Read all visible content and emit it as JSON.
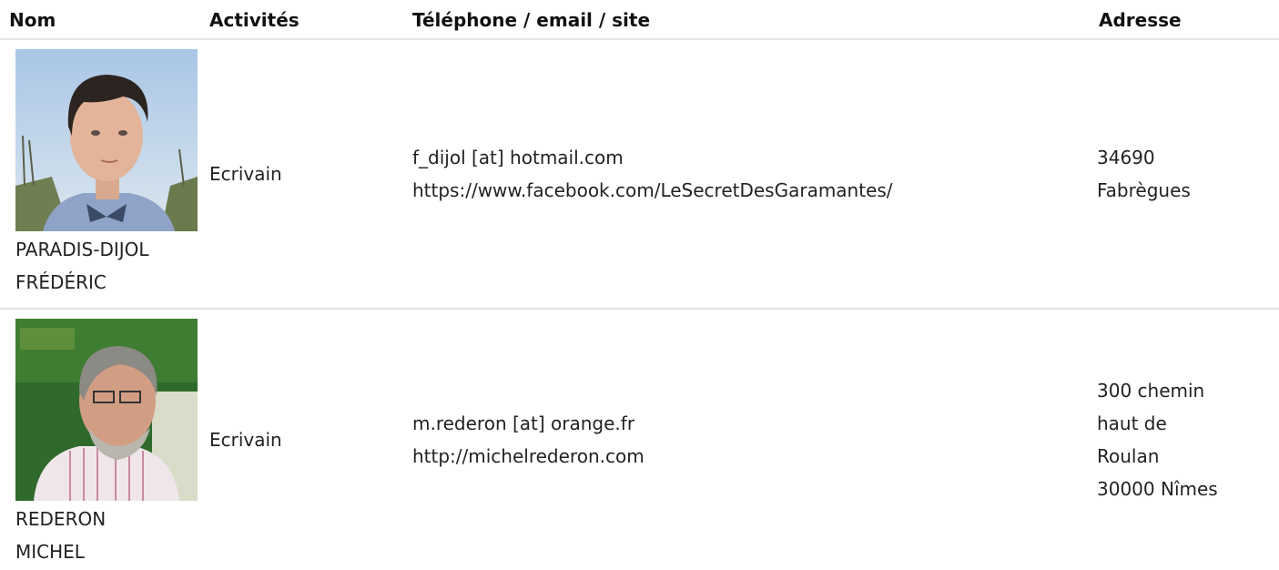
{
  "headers": {
    "nom": "Nom",
    "activites": "Activités",
    "contact": "Téléphone / email / site",
    "adresse": "Adresse"
  },
  "rows": [
    {
      "photo_icon": "portrait-photo-man-bowtie",
      "name": [
        "PARADIS-DIJOL",
        "FRÉDÉRIC"
      ],
      "activite": "Ecrivain",
      "contact": [
        "f_dijol [at] hotmail.com",
        "https://www.facebook.com/LeSecretDesGaramantes/"
      ],
      "adresse": [
        "34690",
        "Fabrègues"
      ]
    },
    {
      "photo_icon": "portrait-photo-man-grey-beard",
      "name": [
        "REDERON",
        "MICHEL"
      ],
      "activite": "Ecrivain",
      "contact": [
        "m.rederon [at] orange.fr",
        "http://michelrederon.com"
      ],
      "adresse": [
        "300 chemin",
        "haut de",
        "Roulan",
        "30000 Nîmes"
      ]
    }
  ]
}
